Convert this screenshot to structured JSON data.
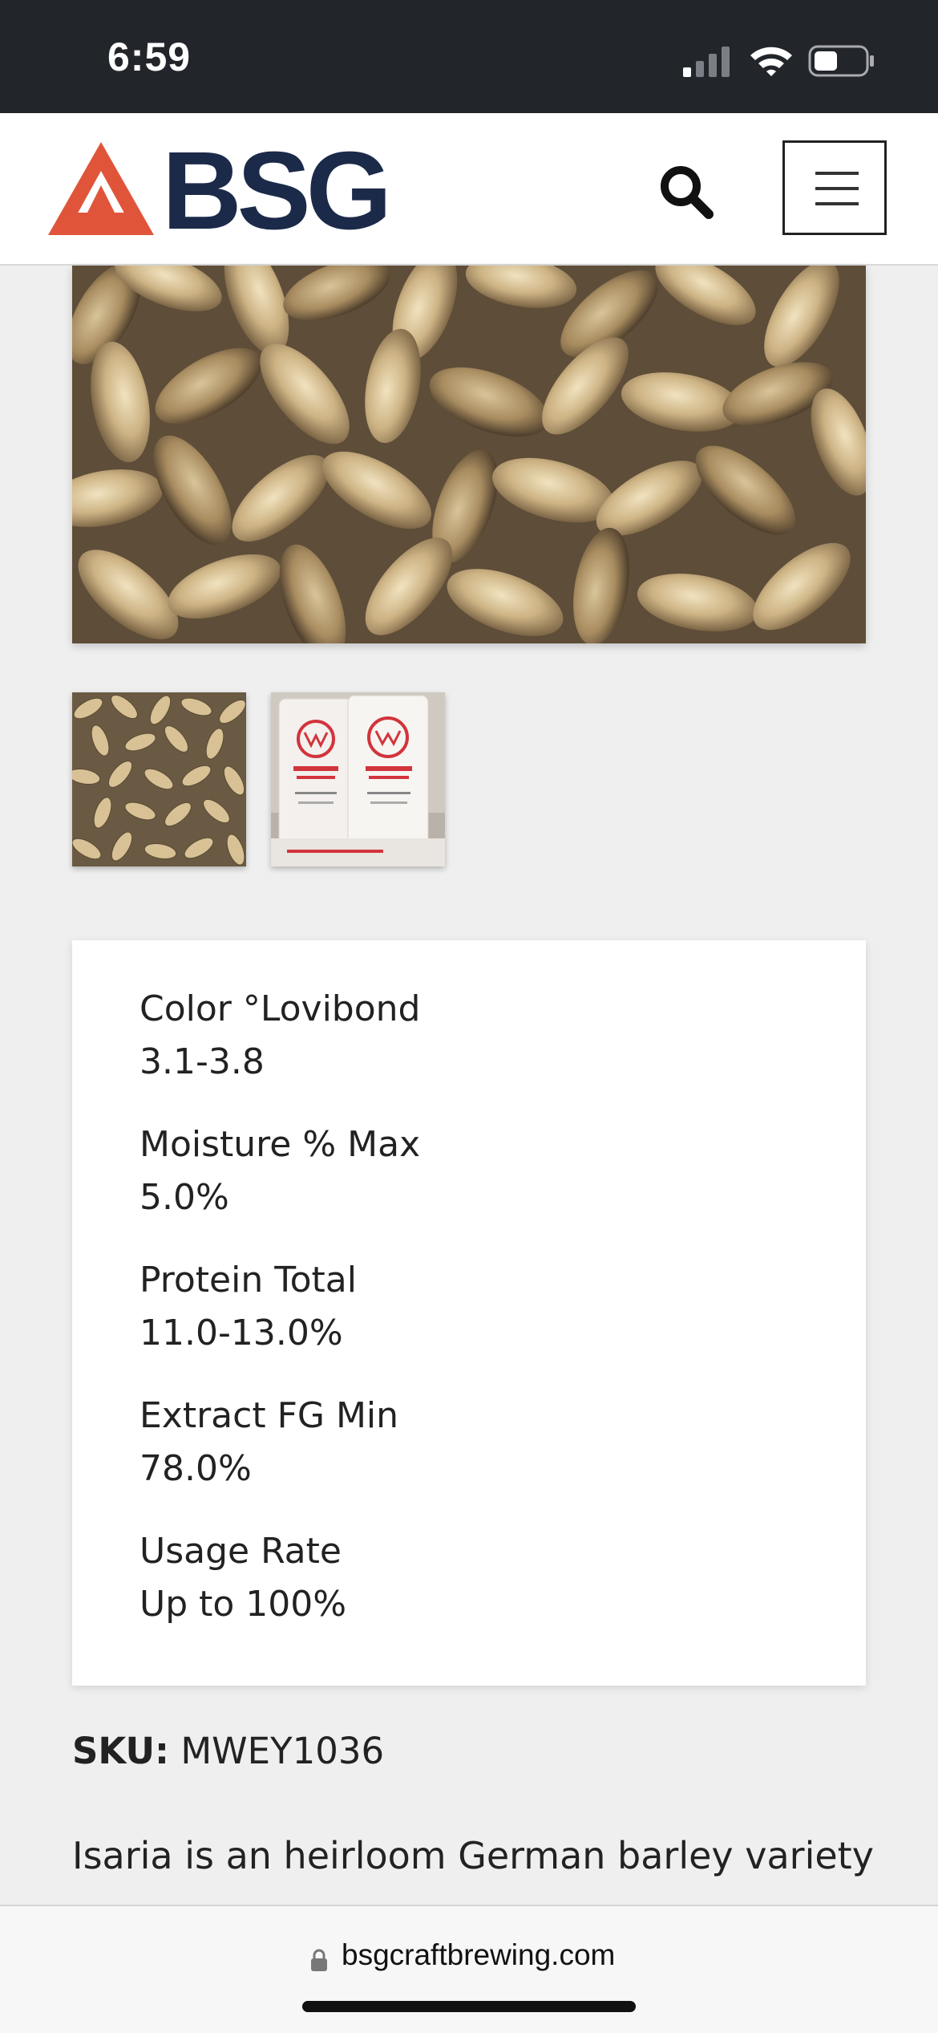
{
  "status_bar": {
    "time": "6:59",
    "signal_icon": "cellular-signal-icon",
    "wifi_icon": "wifi-icon",
    "battery_icon": "battery-icon"
  },
  "header": {
    "logo_text": "BSG",
    "logo_icon": "triangle-logo-icon",
    "search_icon": "search-icon",
    "menu_icon": "hamburger-menu-icon"
  },
  "colors": {
    "brand_navy": "#1c2a4a",
    "brand_orange": "#e0553a",
    "page_background": "#efefef"
  },
  "gallery": {
    "main_image": "malted-barley-grains-photo",
    "thumbnails": [
      "malted-barley-grains-thumbnail",
      "weyermann-malt-bags-thumbnail"
    ]
  },
  "specs": [
    {
      "label": "Color °Lovibond",
      "value": "3.1-3.8"
    },
    {
      "label": "Moisture % Max",
      "value": "5.0%"
    },
    {
      "label": "Protein Total",
      "value": "11.0-13.0%"
    },
    {
      "label": "Extract FG Min",
      "value": "78.0%"
    },
    {
      "label": "Usage Rate",
      "value": "Up to 100%"
    }
  ],
  "sku": {
    "label": "SKU:",
    "value": "MWEY1036"
  },
  "description": "Isaria is an heirloom German barley variety",
  "browser": {
    "url": "bsgcraftbrewing.com",
    "lock_icon": "lock-icon"
  }
}
